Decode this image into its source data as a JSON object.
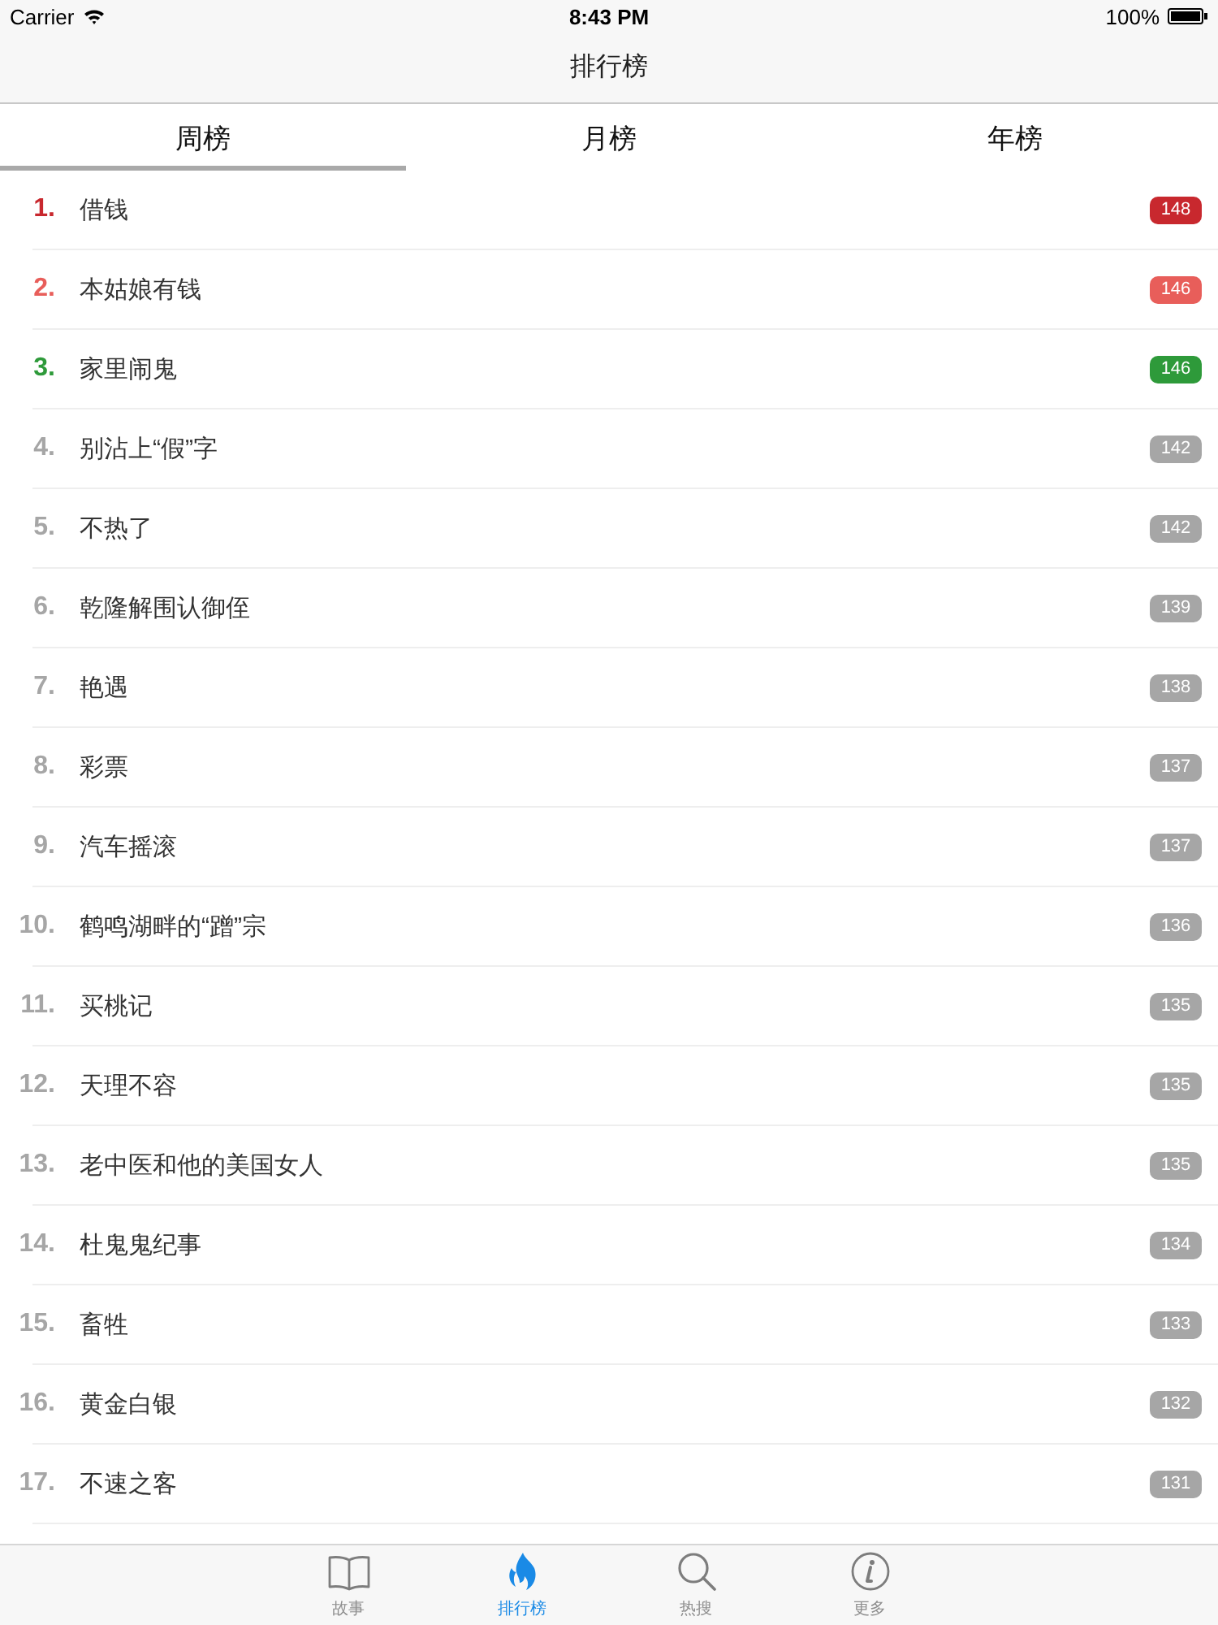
{
  "status_bar": {
    "carrier": "Carrier",
    "time": "8:43 PM",
    "battery": "100%"
  },
  "nav_bar": {
    "title": "排行榜"
  },
  "tabs": [
    {
      "label": "周榜",
      "selected": true
    },
    {
      "label": "月榜",
      "selected": false
    },
    {
      "label": "年榜",
      "selected": false
    }
  ],
  "ranking": [
    {
      "rank": "1.",
      "title": "借钱",
      "count": "148",
      "color": "#c8282e"
    },
    {
      "rank": "2.",
      "title": "本姑娘有钱",
      "count": "146",
      "color": "#e85e5a"
    },
    {
      "rank": "3.",
      "title": "家里闹鬼",
      "count": "146",
      "color": "#2e9a3a"
    },
    {
      "rank": "4.",
      "title": "别沾上“假”字",
      "count": "142",
      "color": "#a6a6a6"
    },
    {
      "rank": "5.",
      "title": "不热了",
      "count": "142",
      "color": "#a6a6a6"
    },
    {
      "rank": "6.",
      "title": "乾隆解围认御侄",
      "count": "139",
      "color": "#a6a6a6"
    },
    {
      "rank": "7.",
      "title": "艳遇",
      "count": "138",
      "color": "#a6a6a6"
    },
    {
      "rank": "8.",
      "title": "彩票",
      "count": "137",
      "color": "#a6a6a6"
    },
    {
      "rank": "9.",
      "title": "汽车摇滚",
      "count": "137",
      "color": "#a6a6a6"
    },
    {
      "rank": "10.",
      "title": "鹤鸣湖畔的“蹭”宗",
      "count": "136",
      "color": "#a6a6a6"
    },
    {
      "rank": "11.",
      "title": "买桃记",
      "count": "135",
      "color": "#a6a6a6"
    },
    {
      "rank": "12.",
      "title": "天理不容",
      "count": "135",
      "color": "#a6a6a6"
    },
    {
      "rank": "13.",
      "title": "老中医和他的美国女人",
      "count": "135",
      "color": "#a6a6a6"
    },
    {
      "rank": "14.",
      "title": "杜鬼鬼纪事",
      "count": "134",
      "color": "#a6a6a6"
    },
    {
      "rank": "15.",
      "title": "畜牲",
      "count": "133",
      "color": "#a6a6a6"
    },
    {
      "rank": "16.",
      "title": "黄金白银",
      "count": "132",
      "color": "#a6a6a6"
    },
    {
      "rank": "17.",
      "title": "不速之客",
      "count": "131",
      "color": "#a6a6a6"
    }
  ],
  "tab_bar": [
    {
      "label": "故事",
      "kind": "book",
      "selected": false
    },
    {
      "label": "排行榜",
      "kind": "flame",
      "selected": true
    },
    {
      "label": "热搜",
      "kind": "search",
      "selected": false
    },
    {
      "label": "更多",
      "kind": "info",
      "selected": false
    }
  ]
}
